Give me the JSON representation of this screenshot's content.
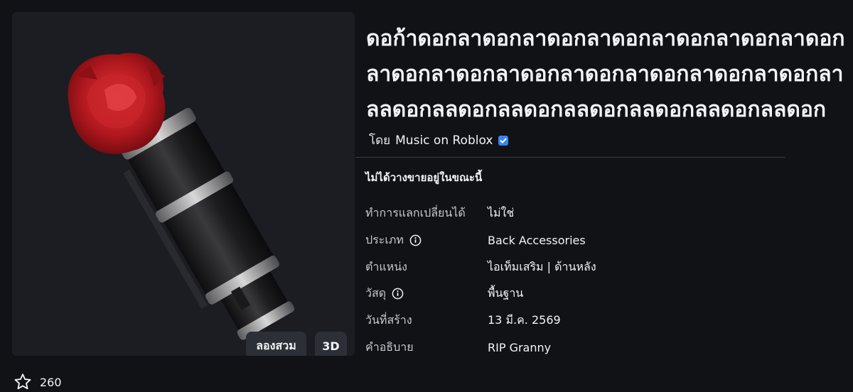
{
  "item": {
    "title_lines": [
      "ดอก้าดอกลาดอกลาดอกลาดอกลาดอกลาดอกลาดอก",
      "ลาดอกลาดอกลาดอกลาดอกลาดอกลาดอกลาดอกลา",
      "ลลดอกลลดอกลลดอกลลดอกลลดอกลลดอกลลดอก"
    ],
    "creator_prefix": "โดย",
    "creator_name": "Music on Roblox",
    "status": "ไม่ได้วางขายอยู่ในขณะนี้"
  },
  "preview": {
    "try_on_label": "ลองสวม",
    "view_3d_label": "3D"
  },
  "details": [
    {
      "label": "ทำการแลกเปลี่ยนได้",
      "value": "ไม่ใช่",
      "info": false
    },
    {
      "label": "ประเภท",
      "value": "Back Accessories",
      "info": true
    },
    {
      "label": "ตำแหน่ง",
      "value": "ไอเท็มเสริม | ด้านหลัง",
      "info": false
    },
    {
      "label": "วัสดุ",
      "value": "พื้นฐาน",
      "info": true
    },
    {
      "label": "วันที่สร้าง",
      "value": "13 มี.ค. 2569",
      "info": false
    },
    {
      "label": "คำอธิบาย",
      "value": "RIP Granny",
      "info": false
    }
  ],
  "favorites": {
    "count": "260",
    "icon": "star-outline-icon"
  },
  "colors": {
    "background": "#111216",
    "panel": "#1b1d22",
    "verified": "#3b82f6"
  }
}
